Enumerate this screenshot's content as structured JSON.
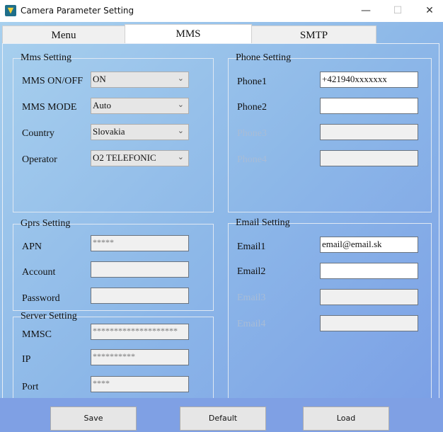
{
  "window": {
    "title": "Camera Parameter Setting",
    "minimize": "—",
    "maximize": "☐",
    "close": "✕"
  },
  "tabs": [
    {
      "label": "Menu"
    },
    {
      "label": "MMS"
    },
    {
      "label": "SMTP"
    }
  ],
  "mms_setting": {
    "title": "Mms Setting",
    "fields": [
      {
        "label": "MMS ON/OFF",
        "value": "ON"
      },
      {
        "label": "MMS MODE",
        "value": "Auto"
      },
      {
        "label": "Country",
        "value": "Slovakia"
      },
      {
        "label": "Operator",
        "value": "O2 TELEFONIC"
      }
    ]
  },
  "gprs_setting": {
    "title": "Gprs Setting",
    "fields": [
      {
        "label": "APN",
        "value": "*****"
      },
      {
        "label": "Account",
        "value": ""
      },
      {
        "label": "Password",
        "value": ""
      }
    ]
  },
  "server_setting": {
    "title": "Server Setting",
    "fields": [
      {
        "label": "MMSC",
        "value": "********************"
      },
      {
        "label": "IP",
        "value": "**********"
      },
      {
        "label": "Port",
        "value": "****"
      }
    ]
  },
  "phone_setting": {
    "title": "Phone Setting",
    "fields": [
      {
        "label": "Phone1",
        "value": "+421940xxxxxxx"
      },
      {
        "label": "Phone2",
        "value": ""
      },
      {
        "label": "Phone3",
        "value": ""
      },
      {
        "label": "Phone4",
        "value": ""
      }
    ]
  },
  "email_setting": {
    "title": "Email Setting",
    "fields": [
      {
        "label": "Email1",
        "value": "email@email.sk"
      },
      {
        "label": "Email2",
        "value": ""
      },
      {
        "label": "Email3",
        "value": ""
      },
      {
        "label": "Email4",
        "value": ""
      }
    ]
  },
  "buttons": {
    "save": "Save",
    "default": "Default",
    "load": "Load"
  }
}
